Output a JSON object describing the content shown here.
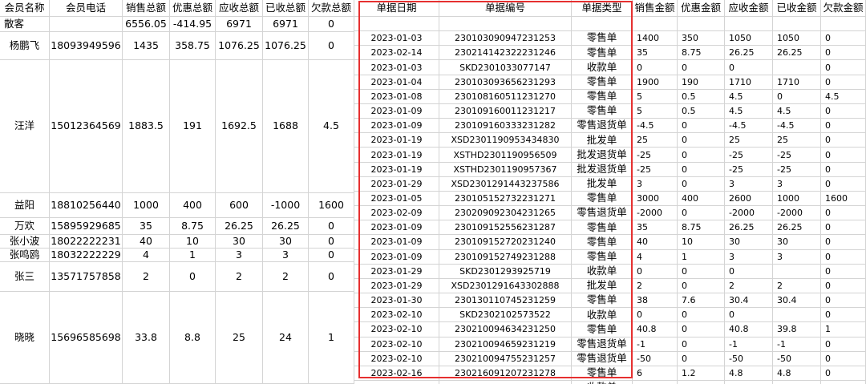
{
  "headers": [
    "会员名称",
    "会员电话",
    "销售总额",
    "优惠总额",
    "应收总额",
    "已收总额",
    "欠款总额",
    "单据日期",
    "单据编号",
    "单据类型",
    "销售金额",
    "优惠金额",
    "应收金额",
    "已收金额",
    "欠款金额"
  ],
  "members": [
    {
      "name": "散客",
      "phone": "",
      "sales": "6556.05",
      "discount": "-414.95",
      "receivable": "6971",
      "received": "6971",
      "debt": "0"
    },
    {
      "name": "杨鹏飞",
      "phone": "18093949596",
      "sales": "1435",
      "discount": "358.75",
      "receivable": "1076.25",
      "received": "1076.25",
      "debt": "0"
    },
    {
      "name": "汪洋",
      "phone": "15012364569",
      "sales": "1883.5",
      "discount": "191",
      "receivable": "1692.5",
      "received": "1688",
      "debt": "4.5"
    },
    {
      "name": "益阳",
      "phone": "18810256440",
      "sales": "1000",
      "discount": "400",
      "receivable": "600",
      "received": "-1000",
      "debt": "1600"
    },
    {
      "name": "万欢",
      "phone": "15895929685",
      "sales": "35",
      "discount": "8.75",
      "receivable": "26.25",
      "received": "26.25",
      "debt": "0"
    },
    {
      "name": "张小波",
      "phone": "18022222231",
      "sales": "40",
      "discount": "10",
      "receivable": "30",
      "received": "30",
      "debt": "0"
    },
    {
      "name": "张鸣鸥",
      "phone": "18032222229",
      "sales": "4",
      "discount": "1",
      "receivable": "3",
      "received": "3",
      "debt": "0"
    },
    {
      "name": "张三",
      "phone": "13571757858",
      "sales": "2",
      "discount": "0",
      "receivable": "2",
      "received": "2",
      "debt": "0"
    },
    {
      "name": "晓晓",
      "phone": "15696585698",
      "sales": "33.8",
      "discount": "8.8",
      "receivable": "25",
      "received": "24",
      "debt": "1"
    }
  ],
  "details": [
    [
      "",
      "",
      "",
      "",
      "",
      "",
      "",
      ""
    ],
    [
      "2023-01-03",
      "230103090947231253",
      "零售单",
      "1400",
      "350",
      "1050",
      "1050",
      "0"
    ],
    [
      "2023-02-14",
      "230214142322231246",
      "零售单",
      "35",
      "8.75",
      "26.25",
      "26.25",
      "0"
    ],
    [
      "2023-01-03",
      "SKD2301033077147",
      "收款单",
      "0",
      "0",
      "0",
      "",
      "0"
    ],
    [
      "2023-01-04",
      "230103093656231293",
      "零售单",
      "1900",
      "190",
      "1710",
      "1710",
      "0"
    ],
    [
      "2023-01-08",
      "230108160511231270",
      "零售单",
      "5",
      "0.5",
      "4.5",
      "0",
      "4.5"
    ],
    [
      "2023-01-09",
      "230109160011231217",
      "零售单",
      "5",
      "0.5",
      "4.5",
      "4.5",
      "0"
    ],
    [
      "2023-01-09",
      "230109160333231282",
      "零售退货单",
      "-4.5",
      "0",
      "-4.5",
      "-4.5",
      "0"
    ],
    [
      "2023-01-19",
      "XSD2301190953434830",
      "批发单",
      "25",
      "0",
      "25",
      "25",
      "0"
    ],
    [
      "2023-01-19",
      "XSTHD2301190956509",
      "批发退货单",
      "-25",
      "0",
      "-25",
      "-25",
      "0"
    ],
    [
      "2023-01-19",
      "XSTHD2301190957367",
      "批发退货单",
      "-25",
      "0",
      "-25",
      "-25",
      "0"
    ],
    [
      "2023-01-29",
      "XSD2301291443237586",
      "批发单",
      "3",
      "0",
      "3",
      "3",
      "0"
    ],
    [
      "2023-01-05",
      "230105152732231271",
      "零售单",
      "3000",
      "400",
      "2600",
      "1000",
      "1600"
    ],
    [
      "2023-02-09",
      "230209092304231265",
      "零售退货单",
      "-2000",
      "0",
      "-2000",
      "-2000",
      "0"
    ],
    [
      "2023-01-09",
      "230109152556231287",
      "零售单",
      "35",
      "8.75",
      "26.25",
      "26.25",
      "0"
    ],
    [
      "2023-01-09",
      "230109152720231240",
      "零售单",
      "40",
      "10",
      "30",
      "30",
      "0"
    ],
    [
      "2023-01-09",
      "230109152749231288",
      "零售单",
      "4",
      "1",
      "3",
      "3",
      "0"
    ],
    [
      "2023-01-29",
      "SKD2301293925719",
      "收款单",
      "0",
      "0",
      "0",
      "",
      "0"
    ],
    [
      "2023-01-29",
      "XSD2301291643302888",
      "批发单",
      "2",
      "0",
      "2",
      "2",
      "0"
    ],
    [
      "2023-01-30",
      "230130110745231259",
      "零售单",
      "38",
      "7.6",
      "30.4",
      "30.4",
      "0"
    ],
    [
      "2023-02-10",
      "SKD2302102573522",
      "收款单",
      "0",
      "0",
      "0",
      "",
      "0"
    ],
    [
      "2023-02-10",
      "230210094634231250",
      "零售单",
      "40.8",
      "0",
      "40.8",
      "39.8",
      "1"
    ],
    [
      "2023-02-10",
      "230210094659231219",
      "零售退货单",
      "-1",
      "0",
      "-1",
      "-1",
      "0"
    ],
    [
      "2023-02-10",
      "230210094755231257",
      "零售退货单",
      "-50",
      "0",
      "-50",
      "-50",
      "0"
    ],
    [
      "2023-02-16",
      "230216091207231278",
      "零售单",
      "6",
      "1.2",
      "4.8",
      "4.8",
      "0"
    ],
    [
      "",
      "",
      "收款单",
      "",
      "",
      "",
      "",
      ""
    ]
  ],
  "colors": {
    "highlight_border": "#e63030",
    "grid": "#d4d4d4"
  }
}
